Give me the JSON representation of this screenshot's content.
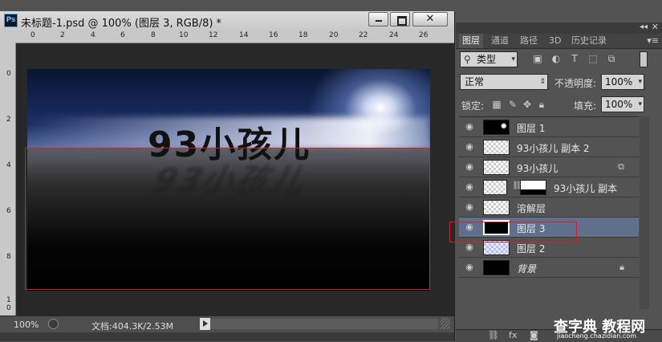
{
  "document": {
    "logo": "Ps",
    "title": "未标题-1.psd @ 100% (图层 3, RGB/8) *"
  },
  "ruler_top": [
    "0",
    "2",
    "4",
    "6",
    "8",
    "10",
    "12",
    "14",
    "16",
    "18",
    "20",
    "22",
    "24",
    "26"
  ],
  "ruler_left": [
    "0",
    "2",
    "4",
    "6",
    "8",
    "1",
    "0"
  ],
  "canvas": {
    "text": "93小孩儿"
  },
  "status": {
    "zoom": "100%",
    "doc_size": "文档:404.3K/2.53M"
  },
  "panel": {
    "collapse_icon": "double-chevron-right",
    "tabs": [
      "图层",
      "通道",
      "路径",
      "3D",
      "历史记录"
    ],
    "filter_kind": "类型",
    "blend_mode": "正常",
    "opacity_label": "不透明度:",
    "opacity_value": "100%",
    "lock_label": "锁定:",
    "fill_label": "填充:",
    "fill_value": "100%"
  },
  "layers": [
    {
      "name": "图层 1",
      "thumb": "black-glow",
      "selected": false
    },
    {
      "name": "93小孩儿 副本 2",
      "thumb": "checker",
      "selected": false
    },
    {
      "name": "93小孩儿",
      "thumb": "checker",
      "selected": false
    },
    {
      "name": "93小孩儿 副本",
      "thumb": "checker",
      "selected": false
    },
    {
      "name": "溶解层",
      "thumb": "checker",
      "selected": false
    },
    {
      "name": "图层 3",
      "thumb": "black",
      "selected": true
    },
    {
      "name": "图层 2",
      "thumb": "checker",
      "selected": false
    },
    {
      "name": "背景",
      "thumb": "black",
      "selected": false
    }
  ],
  "watermark": {
    "main": "查字典 教程网",
    "sub": "jiaocheng.chazidian.com"
  },
  "colors": {
    "selection_red": "#d4202a",
    "selected_layer": "#5f6f8c",
    "panel_bg": "#535353"
  }
}
